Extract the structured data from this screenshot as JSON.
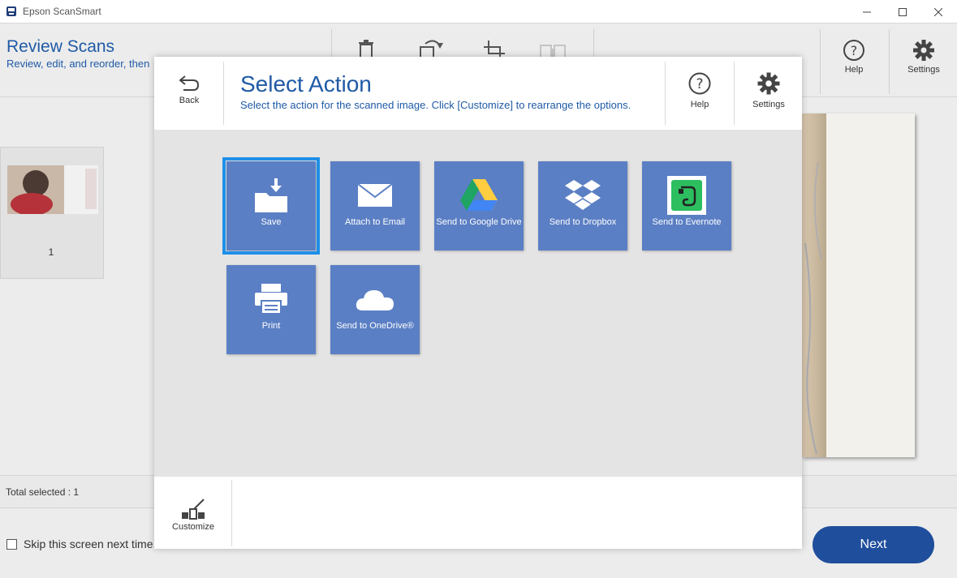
{
  "window": {
    "title": "Epson ScanSmart"
  },
  "background": {
    "title": "Review Scans",
    "subtitle": "Review, edit, and reorder, then",
    "help_label": "Help",
    "settings_label": "Settings",
    "thumbnail_number": "1",
    "total_selected": "Total selected : 1",
    "skip_label": "Skip this screen next time.",
    "next_label": "Next"
  },
  "modal": {
    "back_label": "Back",
    "title": "Select Action",
    "subtitle": "Select the action for the scanned image. Click [Customize] to rearrange the options.",
    "help_label": "Help",
    "settings_label": "Settings",
    "customize_label": "Customize",
    "actions": [
      {
        "label": "Save",
        "icon": "folder-save-icon",
        "selected": true
      },
      {
        "label": "Attach to Email",
        "icon": "envelope-icon",
        "selected": false
      },
      {
        "label": "Send to Google Drive",
        "icon": "google-drive-icon",
        "selected": false
      },
      {
        "label": "Send to Dropbox",
        "icon": "dropbox-icon",
        "selected": false
      },
      {
        "label": "Send to Evernote",
        "icon": "evernote-icon",
        "selected": false
      },
      {
        "label": "Print",
        "icon": "printer-icon",
        "selected": false
      },
      {
        "label": "Send to OneDrive®",
        "icon": "onedrive-cloud-icon",
        "selected": false
      }
    ]
  },
  "colors": {
    "accent_blue": "#1f5aa6",
    "tile_blue": "#5b7fc4",
    "selection_blue": "#1e90e8",
    "next_button": "#1f4e9c"
  }
}
